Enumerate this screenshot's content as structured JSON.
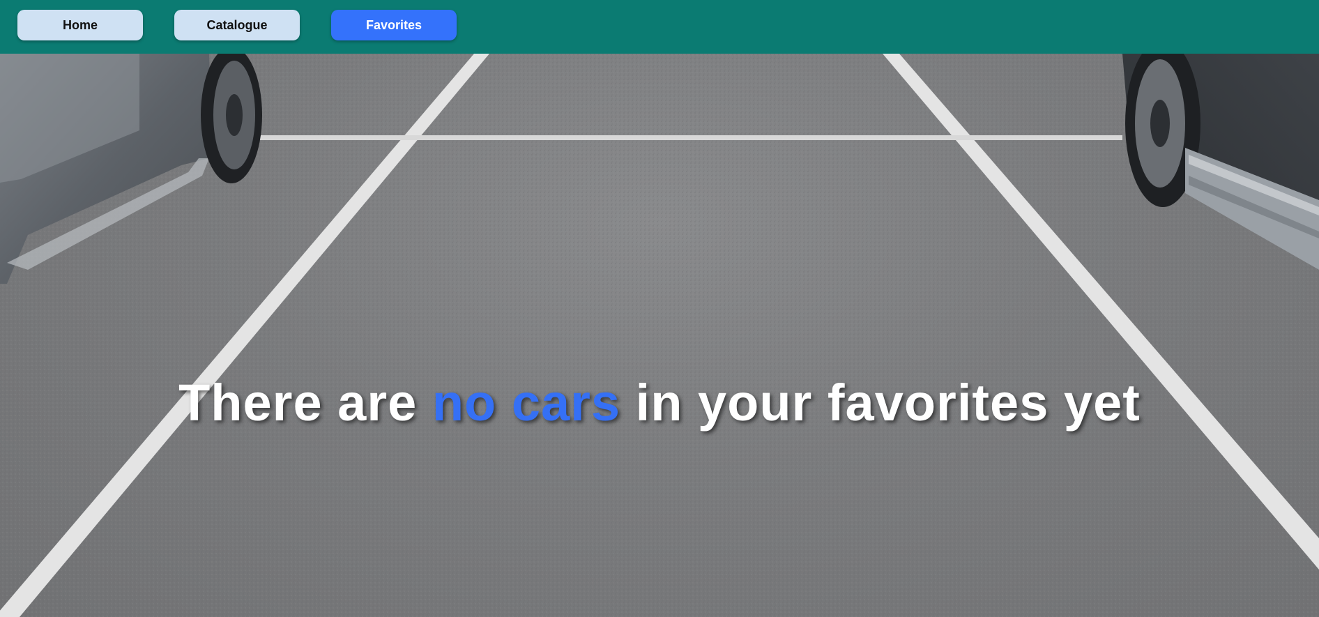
{
  "nav": {
    "home_label": "Home",
    "catalogue_label": "Catalogue",
    "favorites_label": "Favorites",
    "active_item": "Favorites"
  },
  "empty_state": {
    "text_before": "There are ",
    "highlight": "no cars",
    "text_after": " in your favorites yet"
  },
  "colors": {
    "navbar_bg": "#0b7b72",
    "nav_button_bg": "#cfe1f3",
    "nav_button_active_bg": "#3472fb",
    "highlight_text": "#3570f5"
  },
  "background": {
    "image": "parking-lot-photo"
  }
}
